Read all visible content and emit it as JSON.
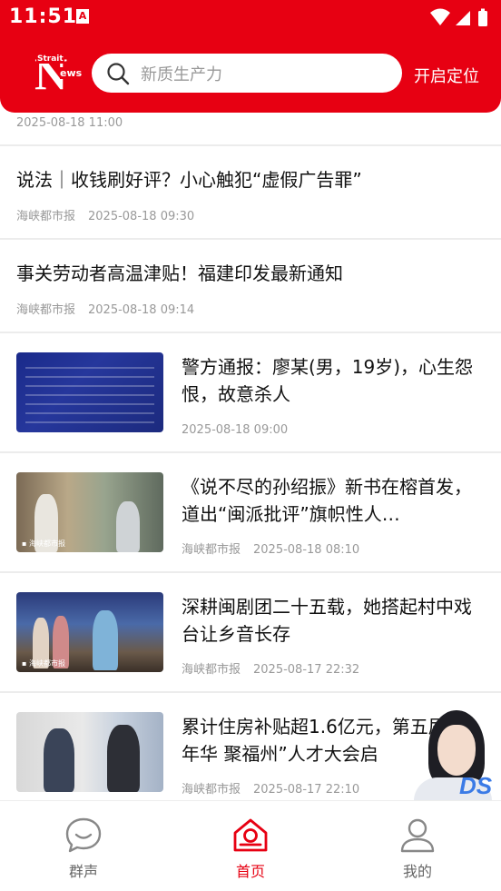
{
  "status_bar": {
    "time": "11:51",
    "notification_glyph": "A"
  },
  "header": {
    "logo": {
      "letter": "N",
      "word_top": "Strait",
      "word_side": "ews"
    },
    "search": {
      "placeholder": "新质生产力",
      "icon": "search-icon"
    },
    "location_button": "开启定位",
    "brand_color": "#e70012"
  },
  "news": {
    "top_partial": {
      "date": "2025-08-18 11:00"
    },
    "items": [
      {
        "title": "说法｜收钱刷好评？小心触犯“虚假广告罪”",
        "source": "海峡都市报",
        "date": "2025-08-18 09:30"
      },
      {
        "title": "事关劳动者高温津贴！福建印发最新通知",
        "source": "海峡都市报",
        "date": "2025-08-18 09:14"
      }
    ],
    "picture_items": [
      {
        "title": "警方通报：廖某(男，19岁)，心生怨恨，故意杀人",
        "source": "",
        "date": "2025-08-18 09:00"
      },
      {
        "title": "《说不尽的孙绍振》新书在榕首发，道出“闽派批评”旗帜性人…",
        "source": "海峡都市报",
        "date": "2025-08-18 08:10"
      },
      {
        "title": "深耕闽剧团二十五载，她搭起村中戏台让乡音长存",
        "source": "海峡都市报",
        "date": "2025-08-17 22:32"
      },
      {
        "title": "累计住房补贴超1.6亿元，第五届“好年华 聚福州”人才大会启",
        "source": "海峡都市报",
        "date": "2025-08-17 22:10"
      }
    ]
  },
  "assistant": {
    "badge": "DS"
  },
  "tabbar": {
    "tabs": [
      {
        "label": "群声",
        "icon": "chat-bubble-icon",
        "active": false
      },
      {
        "label": "首页",
        "icon": "home-icon",
        "active": true
      },
      {
        "label": "我的",
        "icon": "person-icon",
        "active": false
      }
    ]
  }
}
